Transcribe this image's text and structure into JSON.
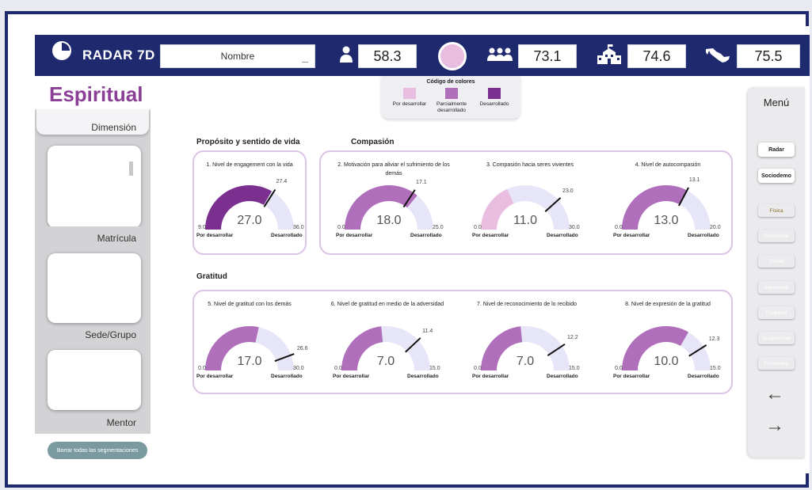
{
  "header": {
    "app_title": "RADAR 7D",
    "name_placeholder": "Nombre",
    "scores": [
      {
        "icon": "person-icon",
        "value": "58.3"
      },
      {
        "icon": "group-icon",
        "value": "73.1"
      },
      {
        "icon": "school-icon",
        "value": "74.6"
      },
      {
        "icon": "mexico-map-icon",
        "value": "75.5"
      }
    ]
  },
  "legend": {
    "title": "Código de colores",
    "items": [
      {
        "label": "Por desarrollar",
        "color": "#e8bde0"
      },
      {
        "label": "Parcialmente desarrollado",
        "color": "#b06fbb"
      },
      {
        "label": "Desarrollado",
        "color": "#7b2f8f"
      }
    ]
  },
  "sidebar": {
    "page_title": "Espiritual",
    "tabs": [
      "Dimensión",
      "Matrícula",
      "Sede/Grupo",
      "Mentor"
    ],
    "clear_button": "Borrar todas las segmentaciones"
  },
  "menu": {
    "title": "Menú",
    "buttons": [
      "Radar",
      "Sociodemo"
    ],
    "dimensions": [
      {
        "label": "Física",
        "color": "#f3d994"
      },
      {
        "label": "Emocional",
        "color": "#de7b72"
      },
      {
        "label": "Social",
        "color": "#e8a56d"
      },
      {
        "label": "Intelectual",
        "color": "#9cc48a"
      },
      {
        "label": "Espiritual",
        "color": "#ad6fb9"
      },
      {
        "label": "Ocupacional",
        "color": "#69b3dc"
      },
      {
        "label": "Financiera",
        "color": "#4c74c7"
      }
    ],
    "arrows": [
      "←",
      "→"
    ]
  },
  "sections": {
    "proposito": "Propósito y sentido de vida",
    "compasion": "Compasión",
    "gratitud": "Gratitud"
  },
  "gauge_labels": {
    "low": "Por desarrollar",
    "high": "Desarrollado"
  },
  "gauges": [
    {
      "title": "1. Nivel de engagement con la vida",
      "value": "27.0",
      "min": "9.0",
      "max": "36.0",
      "target": "27.4",
      "color": "#7b2f8f",
      "v": 27.0,
      "lo": 9,
      "hi": 36,
      "t": 27.4
    },
    {
      "title": "2. Motivación para aliviar el sufrimiento de los demás",
      "value": "18.0",
      "min": "0.0",
      "max": "25.0",
      "target": "17.1",
      "color": "#b06fbb",
      "v": 18.0,
      "lo": 0,
      "hi": 25,
      "t": 17.1
    },
    {
      "title": "3. Compasión hacia seres vivientes",
      "value": "11.0",
      "min": "0.0",
      "max": "30.0",
      "target": "23.0",
      "color": "#e8bde0",
      "v": 11.0,
      "lo": 0,
      "hi": 30,
      "t": 23.0
    },
    {
      "title": "4. Nivel de autocompasión",
      "value": "13.0",
      "min": "0.0",
      "max": "20.0",
      "target": "13.1",
      "color": "#b06fbb",
      "v": 13.0,
      "lo": 0,
      "hi": 20,
      "t": 13.1
    },
    {
      "title": "5. Nivel de gratitud con los demás",
      "value": "17.0",
      "min": "0.0",
      "max": "30.0",
      "target": "26.6",
      "color": "#b06fbb",
      "v": 17.0,
      "lo": 0,
      "hi": 30,
      "t": 26.6
    },
    {
      "title": "6. Nivel de gratitud en medio de la adversidad",
      "value": "7.0",
      "min": "0.0",
      "max": "15.0",
      "target": "11.4",
      "color": "#b06fbb",
      "v": 7.0,
      "lo": 0,
      "hi": 15,
      "t": 11.4
    },
    {
      "title": "7. Nivel de reconocimiento de lo recibido",
      "value": "7.0",
      "min": "0.0",
      "max": "15.0",
      "target": "12.2",
      "color": "#b06fbb",
      "v": 7.0,
      "lo": 0,
      "hi": 15,
      "t": 12.2
    },
    {
      "title": "8. Nivel de expresión de la gratitud",
      "value": "10.0",
      "min": "0.0",
      "max": "15.0",
      "target": "12.3",
      "color": "#b06fbb",
      "v": 10.0,
      "lo": 0,
      "hi": 15,
      "t": 12.3
    }
  ]
}
